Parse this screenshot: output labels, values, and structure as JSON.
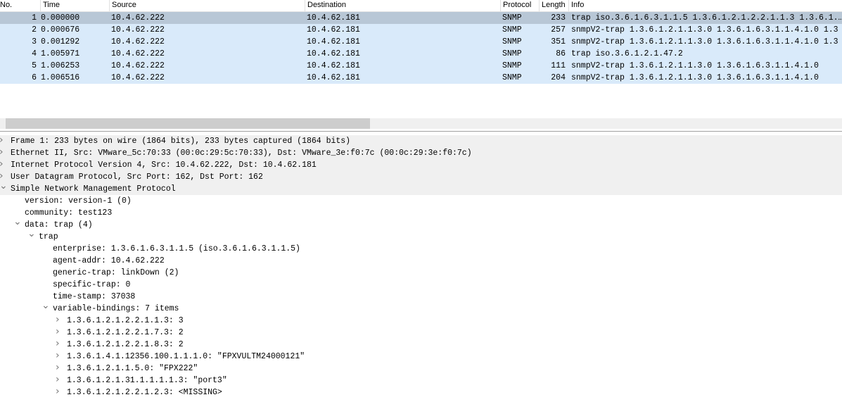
{
  "packet_list": {
    "columns": [
      "No.",
      "Time",
      "Source",
      "Destination",
      "Protocol",
      "Length",
      "Info"
    ],
    "rows": [
      {
        "no": "1",
        "time": "0.000000",
        "source": "10.4.62.222",
        "destination": "10.4.62.181",
        "protocol": "SNMP",
        "length": "233",
        "info": "trap iso.3.6.1.6.3.1.1.5 1.3.6.1.2.1.2.2.1.1.3 1.3.6.1.…"
      },
      {
        "no": "2",
        "time": "0.000676",
        "source": "10.4.62.222",
        "destination": "10.4.62.181",
        "protocol": "SNMP",
        "length": "257",
        "info": "snmpV2-trap 1.3.6.1.2.1.1.3.0 1.3.6.1.6.3.1.1.4.1.0 1.3"
      },
      {
        "no": "3",
        "time": "0.001292",
        "source": "10.4.62.222",
        "destination": "10.4.62.181",
        "protocol": "SNMP",
        "length": "351",
        "info": "snmpV2-trap 1.3.6.1.2.1.1.3.0 1.3.6.1.6.3.1.1.4.1.0 1.3"
      },
      {
        "no": "4",
        "time": "1.005971",
        "source": "10.4.62.222",
        "destination": "10.4.62.181",
        "protocol": "SNMP",
        "length": "86",
        "info": "trap iso.3.6.1.2.1.47.2"
      },
      {
        "no": "5",
        "time": "1.006253",
        "source": "10.4.62.222",
        "destination": "10.4.62.181",
        "protocol": "SNMP",
        "length": "111",
        "info": "snmpV2-trap 1.3.6.1.2.1.1.3.0 1.3.6.1.6.3.1.1.4.1.0"
      },
      {
        "no": "6",
        "time": "1.006516",
        "source": "10.4.62.222",
        "destination": "10.4.62.181",
        "protocol": "SNMP",
        "length": "204",
        "info": "snmpV2-trap 1.3.6.1.2.1.1.3.0 1.3.6.1.6.3.1.1.4.1.0"
      }
    ]
  },
  "details": [
    {
      "text": "Frame 1: 233 bytes on wire (1864 bits), 233 bytes captured (1864 bits)",
      "level": 0,
      "state": "collapsed"
    },
    {
      "text": "Ethernet II, Src: VMware_5c:70:33 (00:0c:29:5c:70:33), Dst: VMware_3e:f0:7c (00:0c:29:3e:f0:7c)",
      "level": 0,
      "state": "collapsed"
    },
    {
      "text": "Internet Protocol Version 4, Src: 10.4.62.222, Dst: 10.4.62.181",
      "level": 0,
      "state": "collapsed"
    },
    {
      "text": "User Datagram Protocol, Src Port: 162, Dst Port: 162",
      "level": 0,
      "state": "collapsed"
    },
    {
      "text": "Simple Network Management Protocol",
      "level": 0,
      "state": "expanded"
    },
    {
      "text": "version: version-1 (0)",
      "level": 1,
      "state": "leaf"
    },
    {
      "text": "community: test123",
      "level": 1,
      "state": "leaf"
    },
    {
      "text": "data: trap (4)",
      "level": 1,
      "state": "expanded"
    },
    {
      "text": "trap",
      "level": 2,
      "state": "expanded"
    },
    {
      "text": "enterprise: 1.3.6.1.6.3.1.1.5 (iso.3.6.1.6.3.1.1.5)",
      "level": 3,
      "state": "leaf"
    },
    {
      "text": "agent-addr: 10.4.62.222",
      "level": 3,
      "state": "leaf"
    },
    {
      "text": "generic-trap: linkDown (2)",
      "level": 3,
      "state": "leaf"
    },
    {
      "text": "specific-trap: 0",
      "level": 3,
      "state": "leaf"
    },
    {
      "text": "time-stamp: 37038",
      "level": 3,
      "state": "leaf"
    },
    {
      "text": "variable-bindings: 7 items",
      "level": 3,
      "state": "expanded"
    },
    {
      "text": "1.3.6.1.2.1.2.2.1.1.3: 3",
      "level": 4,
      "state": "collapsed"
    },
    {
      "text": "1.3.6.1.2.1.2.2.1.7.3: 2",
      "level": 4,
      "state": "collapsed"
    },
    {
      "text": "1.3.6.1.2.1.2.2.1.8.3: 2",
      "level": 4,
      "state": "collapsed"
    },
    {
      "text": "1.3.6.1.4.1.12356.100.1.1.1.0: \"FPXVULTM24000121\"",
      "level": 4,
      "state": "collapsed"
    },
    {
      "text": "1.3.6.1.2.1.1.5.0: \"FPX222\"",
      "level": 4,
      "state": "collapsed"
    },
    {
      "text": "1.3.6.1.2.1.31.1.1.1.1.3: \"port3\"",
      "level": 4,
      "state": "collapsed"
    },
    {
      "text": "1.3.6.1.2.1.2.2.1.2.3: <MISSING>",
      "level": 4,
      "state": "collapsed"
    }
  ]
}
